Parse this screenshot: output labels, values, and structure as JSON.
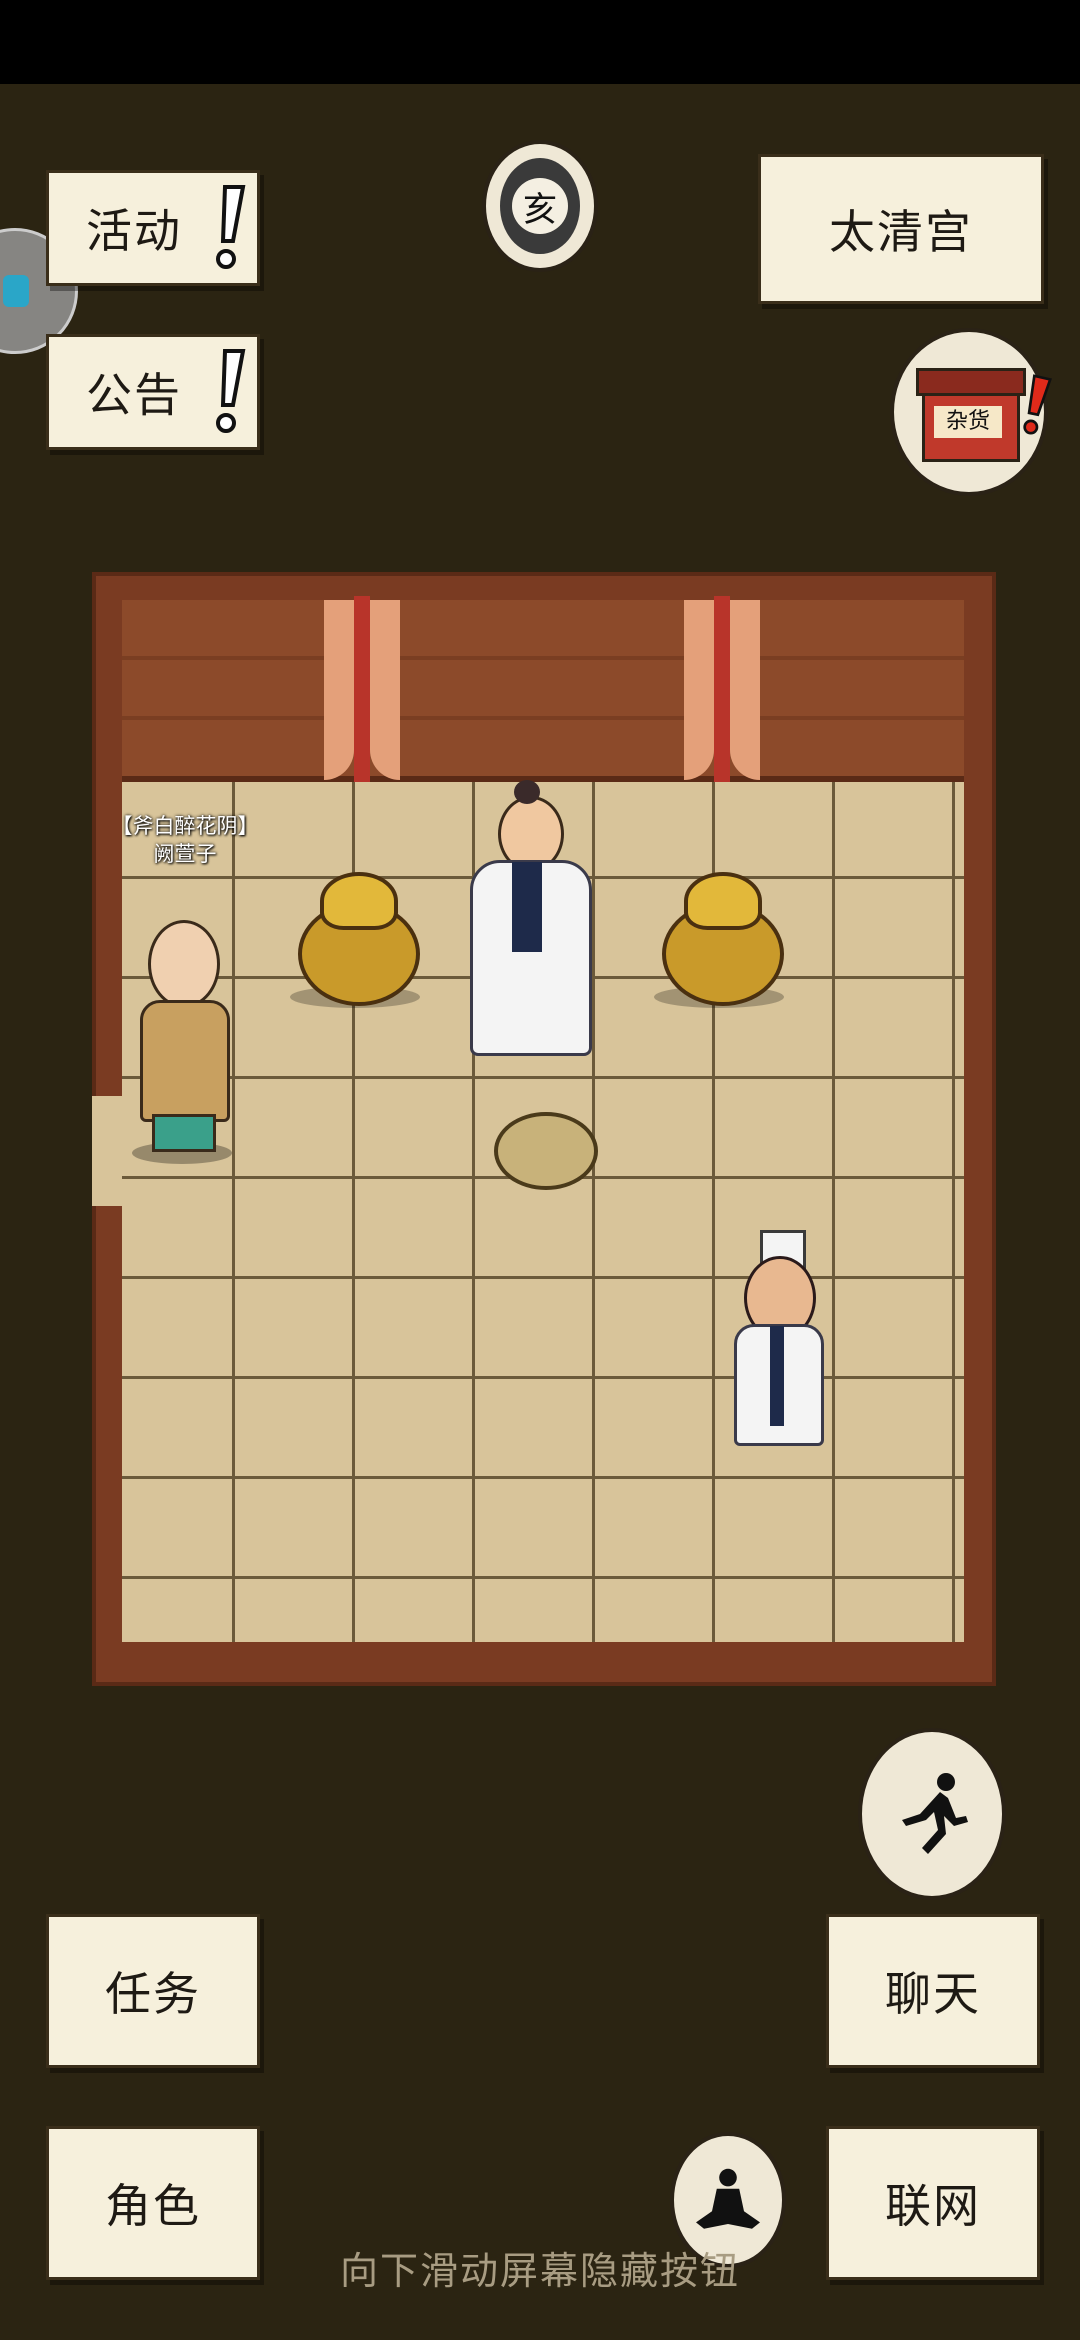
{
  "buttons": {
    "activity": "活动",
    "notice": "公告",
    "location": "太清宫",
    "task": "任务",
    "chat": "聊天",
    "role": "角色",
    "network": "联网"
  },
  "time_badge": "亥",
  "shop_sign": "杂货",
  "npc": {
    "title": "【斧白醉花阴】",
    "name": "阙萱子"
  },
  "hint": "向下滑动屏幕隐藏按钮",
  "icons": {
    "time": "clock-badge-icon",
    "shop": "shop-icon",
    "run": "run-icon",
    "meditate": "meditate-icon",
    "floating": "floating-assistant-icon"
  },
  "colors": {
    "background": "#2b2412",
    "paper": "#f6f0dc",
    "alert": "#e02a1a"
  }
}
